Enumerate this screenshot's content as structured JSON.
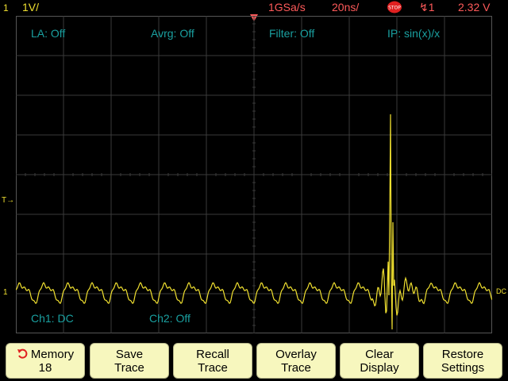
{
  "status": {
    "channel_number": "1",
    "volts_per_div": "1V/",
    "sample_rate": "1GSa/s",
    "time_per_div": "20ns/",
    "run_state_icon": "stop-icon",
    "trigger_icon": "trigger-edge-icon",
    "trigger_source": "1",
    "trigger_level": "2.32 V"
  },
  "overlays": {
    "line_averaging": "LA: Off",
    "averaging": "Avrg: Off",
    "filter": "Filter: Off",
    "interpolation": "IP: sin(x)/x",
    "ch1_coupling": "Ch1: DC",
    "ch2_state": "Ch2: Off"
  },
  "markers": {
    "trigger_level": "T→",
    "ch1_ground": "1",
    "dc_right": "DC"
  },
  "softkeys": [
    {
      "line1": "Memory",
      "line2": "18",
      "icon": "undo-icon"
    },
    {
      "line1": "Save",
      "line2": "Trace"
    },
    {
      "line1": "Recall",
      "line2": "Trace"
    },
    {
      "line1": "Overlay",
      "line2": "Trace"
    },
    {
      "line1": "Clear",
      "line2": "Display"
    },
    {
      "line1": "Restore",
      "line2": "Settings"
    }
  ],
  "colors": {
    "trace": "#f0e030",
    "status_red": "#ff5a5a",
    "overlay_text": "#1aa0a0",
    "grid": "#3a3a3a",
    "softkey_bg": "#f7f7be"
  }
}
